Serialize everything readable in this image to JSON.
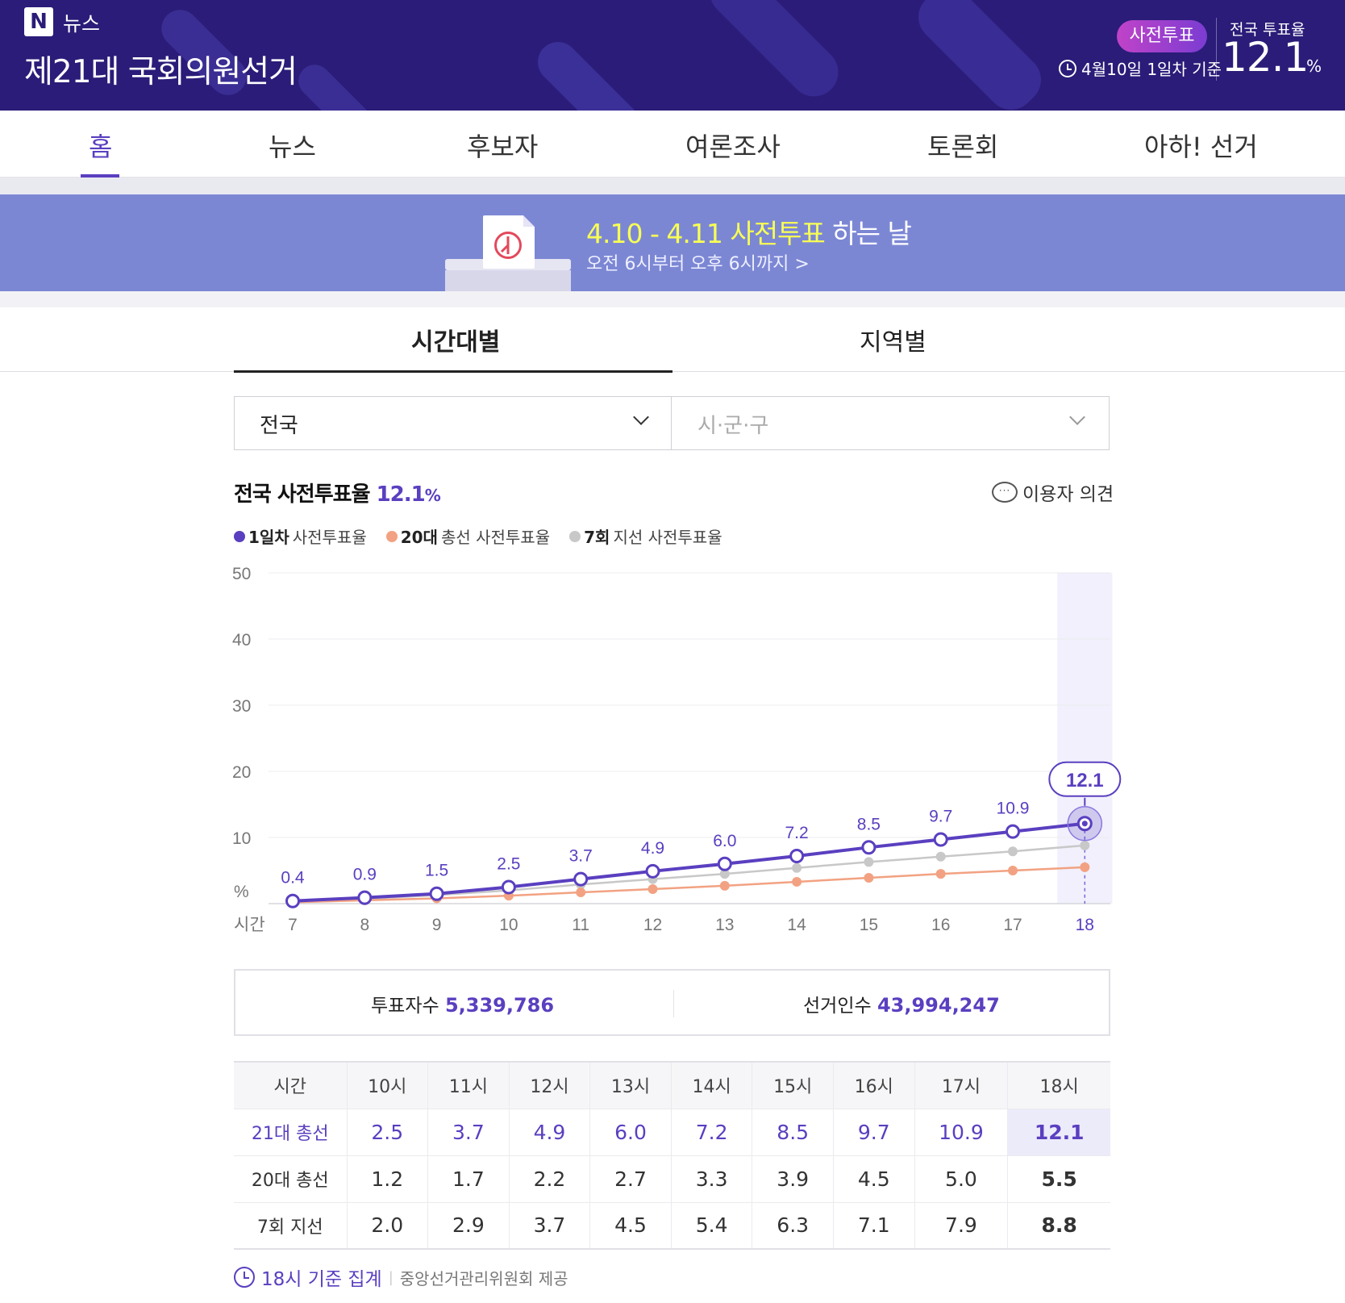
{
  "header": {
    "logo_letter": "N",
    "logo_text": "뉴스",
    "title": "제21대 국회의원선거",
    "badge": "사전투표",
    "basis": "4월10일 1일차 기준",
    "rate_label": "전국 투표율",
    "rate_value": "12.1",
    "rate_unit": "%"
  },
  "nav": {
    "items": [
      {
        "label": "홈"
      },
      {
        "label": "뉴스"
      },
      {
        "label": "후보자"
      },
      {
        "label": "여론조사"
      },
      {
        "label": "토론회"
      },
      {
        "label": "아하! 선거"
      }
    ],
    "active_index": 0
  },
  "banner": {
    "title_highlight": "4.10 - 4.11 사전투표",
    "title_rest": " 하는 날",
    "subtitle": "오전 6시부터 오후 6시까지 >"
  },
  "tabs": {
    "items": [
      {
        "label": "시간대별"
      },
      {
        "label": "지역별"
      }
    ],
    "active_index": 0
  },
  "selects": {
    "region": "전국",
    "district_placeholder": "시·군·구"
  },
  "chart_heading": {
    "title": "전국 사전투표율",
    "value": "12.1",
    "unit": "%",
    "opinion": "이용자 의견",
    "opinion_glyph": "···"
  },
  "legend": [
    {
      "bold": "1일차",
      "rest": " 사전투표율",
      "color": "#5a3fc0"
    },
    {
      "bold": "20대",
      "rest": " 총선 사전투표율",
      "color": "#f2a282"
    },
    {
      "bold": "7회",
      "rest": " 지선 사전투표율",
      "color": "#c8c8c8"
    }
  ],
  "chart_data": {
    "type": "line",
    "x": [
      7,
      8,
      9,
      10,
      11,
      12,
      13,
      14,
      15,
      16,
      17,
      18
    ],
    "xlabel": "시간",
    "ylabel": "%",
    "ylim": [
      0,
      50
    ],
    "yticks": [
      10,
      20,
      30,
      40,
      50
    ],
    "grid": true,
    "highlight_x": 18,
    "series": [
      {
        "name": "1일차 사전투표율",
        "color": "#5a3fc0",
        "values": [
          0.4,
          0.9,
          1.5,
          2.5,
          3.7,
          4.9,
          6.0,
          7.2,
          8.5,
          9.7,
          10.9,
          12.1
        ],
        "labels": [
          "0.4",
          "0.9",
          "1.5",
          "2.5",
          "3.7",
          "4.9",
          "6.0",
          "7.2",
          "8.5",
          "9.7",
          "10.9",
          "12.1"
        ]
      },
      {
        "name": "20대 총선 사전투표율",
        "color": "#f2a282",
        "values": [
          0.2,
          0.5,
          0.8,
          1.2,
          1.7,
          2.2,
          2.7,
          3.3,
          3.9,
          4.5,
          5.0,
          5.5
        ]
      },
      {
        "name": "7회 지선 사전투표율",
        "color": "#c8c8c8",
        "values": [
          0.3,
          0.7,
          1.3,
          2.0,
          2.9,
          3.7,
          4.5,
          5.4,
          6.3,
          7.1,
          7.9,
          8.8
        ]
      }
    ]
  },
  "summary": {
    "voters_label": "투표자수",
    "voters_value": "5,339,786",
    "electors_label": "선거인수",
    "electors_value": "43,994,247"
  },
  "table": {
    "headers": [
      "시간",
      "10시",
      "11시",
      "12시",
      "13시",
      "14시",
      "15시",
      "16시",
      "17시",
      "18시"
    ],
    "rows": [
      {
        "label": "21대 총선",
        "values": [
          "2.5",
          "3.7",
          "4.9",
          "6.0",
          "7.2",
          "8.5",
          "9.7",
          "10.9",
          "12.1"
        ]
      },
      {
        "label": "20대 총선",
        "values": [
          "1.2",
          "1.7",
          "2.2",
          "2.7",
          "3.3",
          "3.9",
          "4.5",
          "5.0",
          "5.5"
        ]
      },
      {
        "label": "7회 지선",
        "values": [
          "2.0",
          "2.9",
          "3.7",
          "4.5",
          "5.4",
          "6.3",
          "7.1",
          "7.9",
          "8.8"
        ]
      }
    ]
  },
  "footer": {
    "main": "18시 기준 집계",
    "separator": "|",
    "source": "중앙선거관리위원회 제공"
  }
}
